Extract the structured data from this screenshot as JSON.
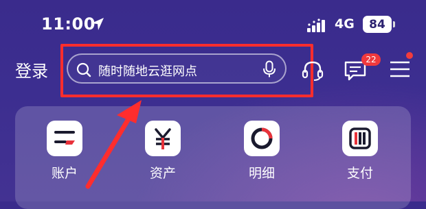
{
  "status_bar": {
    "time": "11:00",
    "network": "4G",
    "battery": "84"
  },
  "header": {
    "login_label": "登录",
    "search_placeholder": "随时随地云逛网点",
    "message_badge": "22"
  },
  "quick_menu": [
    {
      "label": "账户",
      "icon": "account-card-icon"
    },
    {
      "label": "资产",
      "icon": "yuan-icon"
    },
    {
      "label": "明细",
      "icon": "pie-chart-icon"
    },
    {
      "label": "支付",
      "icon": "payment-icon"
    }
  ],
  "colors": {
    "accent_red": "#ff2d2d",
    "badge_red": "#f0393d",
    "bg_purple": "#3c2e90"
  }
}
